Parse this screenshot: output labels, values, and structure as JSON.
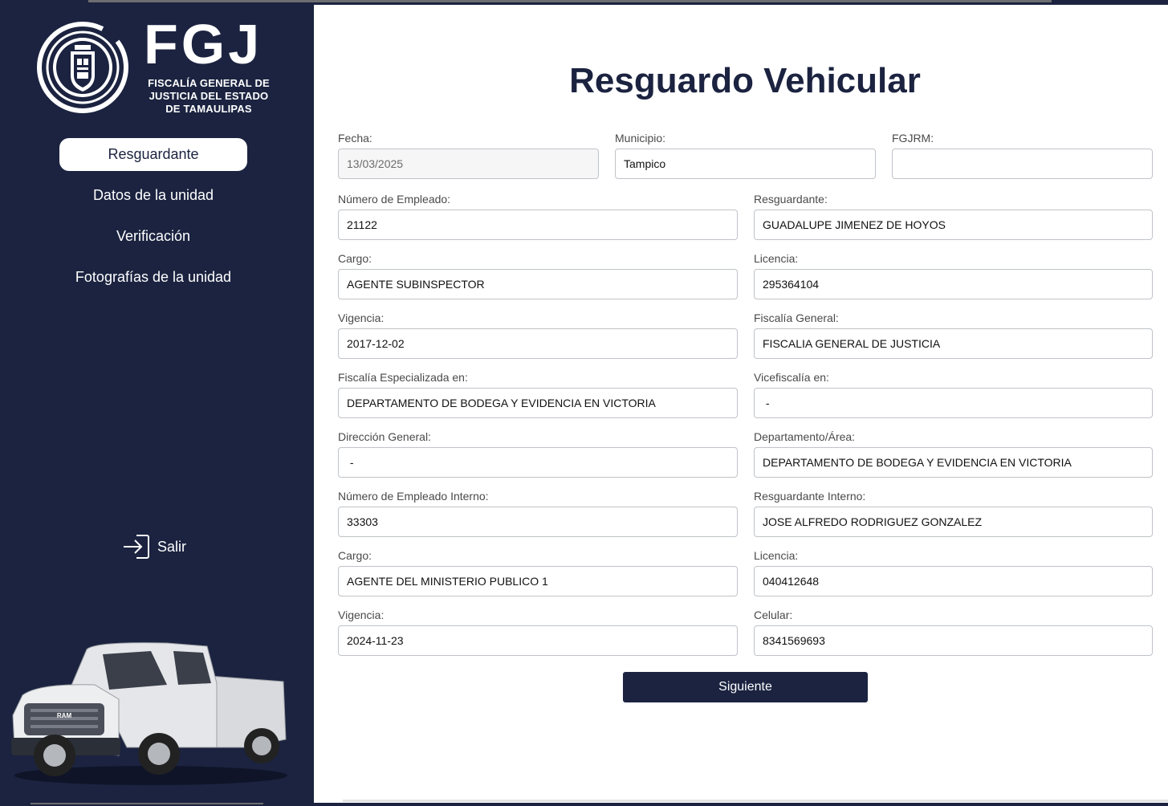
{
  "brand": {
    "acronym": "FGJ",
    "org_name": "FISCALÍA GENERAL DE\nJUSTICIA DEL ESTADO\nDE TAMAULIPAS"
  },
  "nav": {
    "items": [
      {
        "label": "Resguardante",
        "active": true
      },
      {
        "label": "Datos de la unidad",
        "active": false
      },
      {
        "label": "Verificación",
        "active": false
      },
      {
        "label": "Fotografías de la unidad",
        "active": false
      }
    ],
    "logout_label": "Salir"
  },
  "page": {
    "title": "Resguardo Vehicular"
  },
  "form": {
    "fecha": {
      "label": "Fecha:",
      "value": "13/03/2025"
    },
    "municipio": {
      "label": "Municipio:",
      "value": "Tampico"
    },
    "fgjrm": {
      "label": "FGJRM:",
      "value": ""
    },
    "numero_empleado": {
      "label": "Número de Empleado:",
      "value": "21122"
    },
    "resguardante": {
      "label": "Resguardante:",
      "value": "GUADALUPE JIMENEZ DE HOYOS"
    },
    "cargo": {
      "label": "Cargo:",
      "value": "AGENTE SUBINSPECTOR"
    },
    "licencia": {
      "label": "Licencia:",
      "value": "295364104"
    },
    "vigencia": {
      "label": "Vigencia:",
      "value": "2017-12-02"
    },
    "fiscalia_general": {
      "label": "Fiscalía General:",
      "value": "FISCALIA GENERAL DE JUSTICIA"
    },
    "fiscalia_especializada": {
      "label": "Fiscalía Especializada en:",
      "value": "DEPARTAMENTO DE BODEGA Y EVIDENCIA EN VICTORIA"
    },
    "vicefiscalia": {
      "label": "Vicefiscalía en:",
      "value": " -"
    },
    "direccion_general": {
      "label": "Dirección General:",
      "value": " -"
    },
    "departamento_area": {
      "label": "Departamento/Área:",
      "value": "DEPARTAMENTO DE BODEGA Y EVIDENCIA EN VICTORIA"
    },
    "numero_empleado_interno": {
      "label": "Número de Empleado Interno:",
      "value": "33303"
    },
    "resguardante_interno": {
      "label": "Resguardante Interno:",
      "value": "JOSE ALFREDO RODRIGUEZ GONZALEZ"
    },
    "cargo_interno": {
      "label": "Cargo:",
      "value": "AGENTE DEL MINISTERIO PUBLICO 1"
    },
    "licencia_interno": {
      "label": "Licencia:",
      "value": "040412648"
    },
    "vigencia_interno": {
      "label": "Vigencia:",
      "value": "2024-11-23"
    },
    "celular": {
      "label": "Celular:",
      "value": "8341569693"
    }
  },
  "actions": {
    "next_label": "Siguiente"
  },
  "colors": {
    "navy": "#1b2340",
    "white": "#ffffff",
    "input_border": "#bfc3c8"
  }
}
